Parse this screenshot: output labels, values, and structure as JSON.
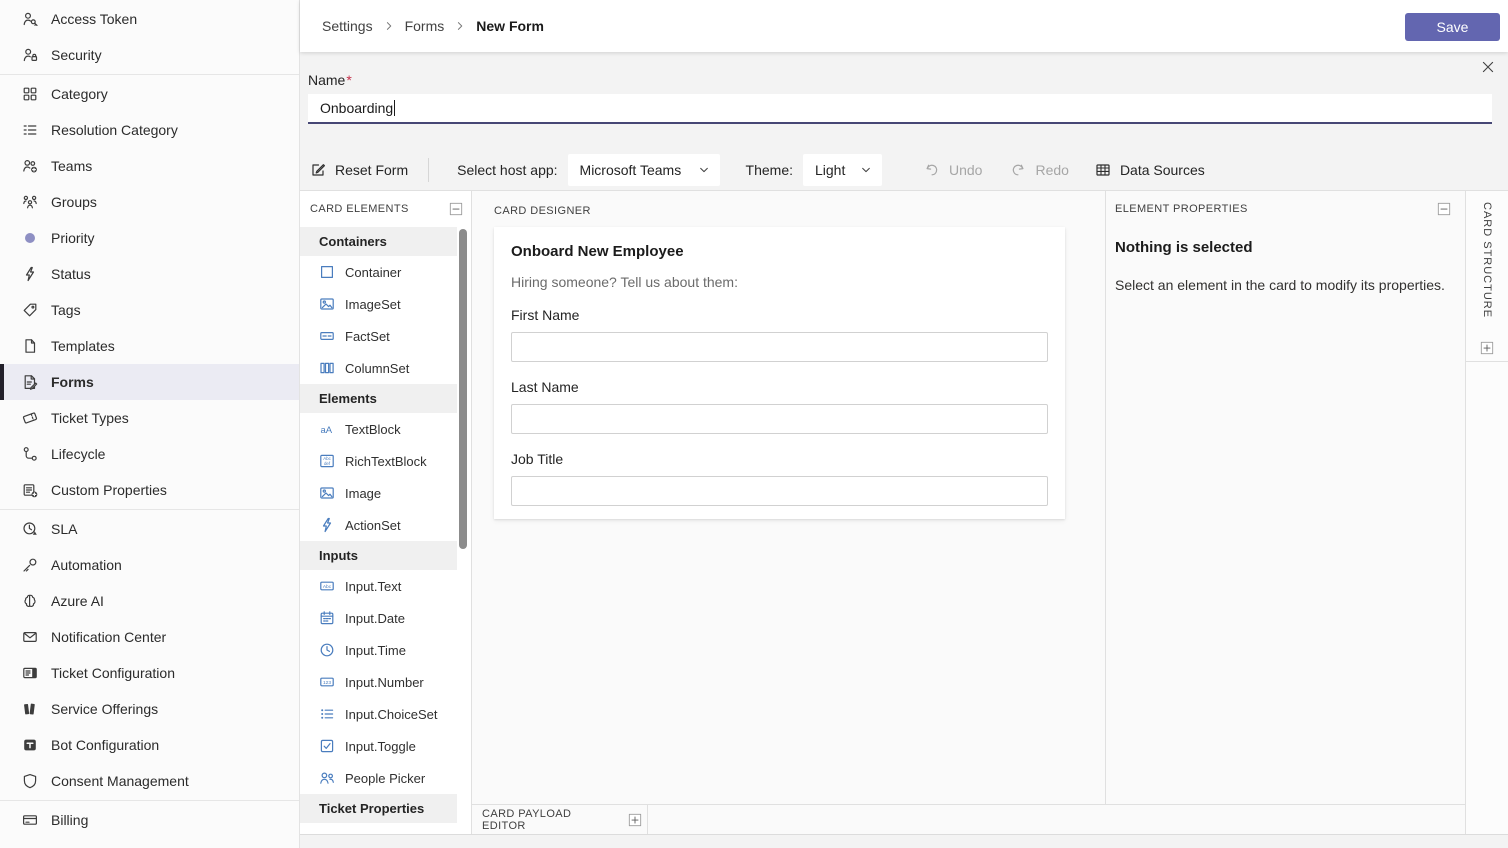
{
  "sidebar": {
    "items": [
      {
        "label": "Access Token"
      },
      {
        "label": "Security"
      },
      {
        "label": "Category"
      },
      {
        "label": "Resolution Category"
      },
      {
        "label": "Teams"
      },
      {
        "label": "Groups"
      },
      {
        "label": "Priority"
      },
      {
        "label": "Status"
      },
      {
        "label": "Tags"
      },
      {
        "label": "Templates"
      },
      {
        "label": "Forms"
      },
      {
        "label": "Ticket Types"
      },
      {
        "label": "Lifecycle"
      },
      {
        "label": "Custom Properties"
      },
      {
        "label": "SLA"
      },
      {
        "label": "Automation"
      },
      {
        "label": "Azure AI"
      },
      {
        "label": "Notification Center"
      },
      {
        "label": "Ticket Configuration"
      },
      {
        "label": "Service Offerings"
      },
      {
        "label": "Bot Configuration"
      },
      {
        "label": "Consent Management"
      },
      {
        "label": "Billing"
      }
    ],
    "selected": "Forms"
  },
  "header": {
    "breadcrumb": [
      "Settings",
      "Forms",
      "New Form"
    ],
    "save_label": "Save"
  },
  "form": {
    "name_label": "Name",
    "required_mark": "*",
    "name_value": "Onboarding"
  },
  "toolbar": {
    "reset_label": "Reset Form",
    "host_app_label": "Select host app:",
    "host_app_value": "Microsoft Teams",
    "theme_label": "Theme:",
    "theme_value": "Light",
    "undo_label": "Undo",
    "redo_label": "Redo",
    "data_sources_label": "Data Sources"
  },
  "elements_panel": {
    "title": "CARD ELEMENTS",
    "sections": [
      {
        "title": "Containers",
        "items": [
          "Container",
          "ImageSet",
          "FactSet",
          "ColumnSet"
        ]
      },
      {
        "title": "Elements",
        "items": [
          "TextBlock",
          "RichTextBlock",
          "Image",
          "ActionSet"
        ]
      },
      {
        "title": "Inputs",
        "items": [
          "Input.Text",
          "Input.Date",
          "Input.Time",
          "Input.Number",
          "Input.ChoiceSet",
          "Input.Toggle",
          "People Picker"
        ]
      },
      {
        "title": "Ticket Properties",
        "items": []
      }
    ]
  },
  "designer": {
    "title": "CARD DESIGNER",
    "card": {
      "title": "Onboard New Employee",
      "subtitle": "Hiring someone? Tell us about them:",
      "fields": [
        {
          "label": "First Name",
          "value": ""
        },
        {
          "label": "Last Name",
          "value": ""
        },
        {
          "label": "Job Title",
          "value": ""
        }
      ]
    }
  },
  "payload_editor": {
    "title": "CARD PAYLOAD EDITOR"
  },
  "properties_panel": {
    "title": "ELEMENT PROPERTIES",
    "empty_title": "Nothing is selected",
    "empty_hint": "Select an element in the card to modify its properties."
  },
  "structure_panel": {
    "title": "CARD STRUCTURE"
  },
  "colors": {
    "accent_purple": "#6366b0",
    "name_underline": "#464775",
    "element_icon_blue": "#4a7dbe",
    "selected_item_bg": "#ebebf3",
    "priority_dot": "#8e8fc3",
    "required_red": "#c4314b"
  }
}
